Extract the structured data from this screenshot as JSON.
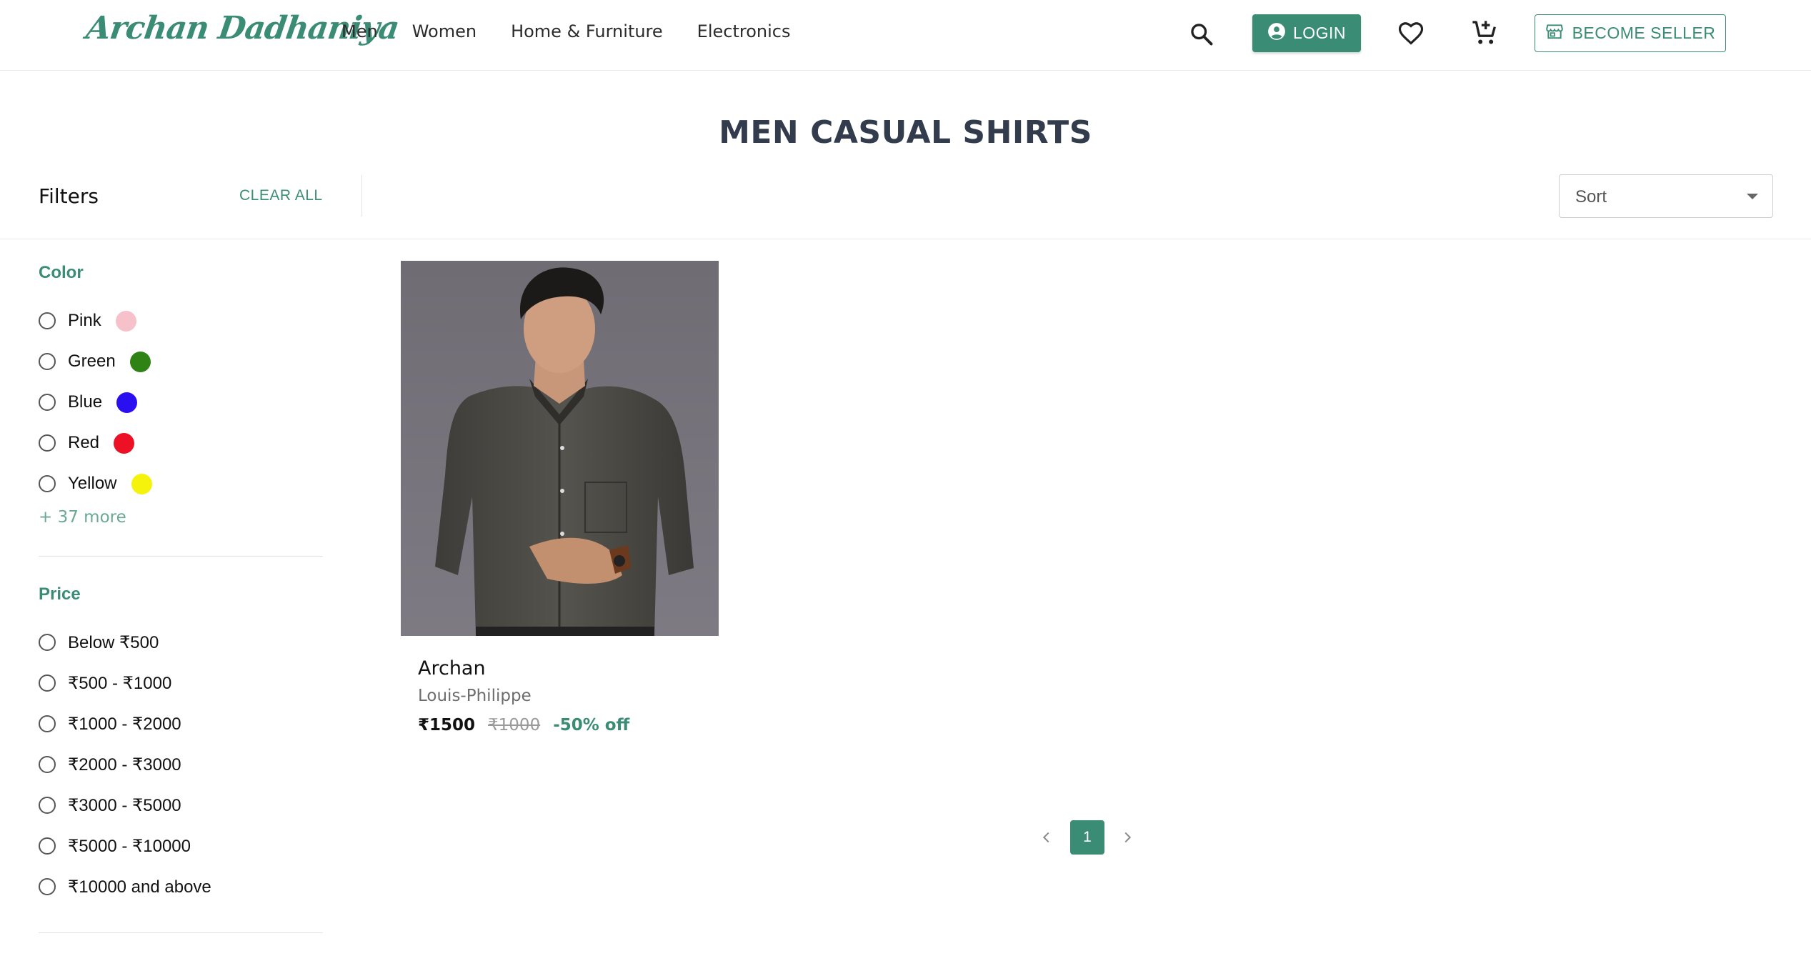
{
  "header": {
    "logo": "Archan Dadhaniya",
    "nav": [
      "Men",
      "Women",
      "Home & Furniture",
      "Electronics"
    ],
    "search_icon": "search-icon",
    "login_label": "LOGIN",
    "login_icon": "account-circle-icon",
    "wishlist_icon": "heart-icon",
    "cart_icon": "add-to-cart-icon",
    "seller_label": "BECOME SELLER",
    "seller_icon": "storefront-icon"
  },
  "page": {
    "title": "MEN CASUAL SHIRTS"
  },
  "filters": {
    "heading": "Filters",
    "clear_all": "CLEAR ALL",
    "color": {
      "title": "Color",
      "options": [
        {
          "label": "Pink",
          "swatch": "#f6c1cb"
        },
        {
          "label": "Green",
          "swatch": "#2f8214"
        },
        {
          "label": "Blue",
          "swatch": "#2a0ff0"
        },
        {
          "label": "Red",
          "swatch": "#ed1125"
        },
        {
          "label": "Yellow",
          "swatch": "#f5f20c"
        }
      ],
      "more": "+ 37 more"
    },
    "price": {
      "title": "Price",
      "options": [
        "Below ₹500",
        "₹500 - ₹1000",
        "₹1000 - ₹2000",
        "₹2000 - ₹3000",
        "₹3000 - ₹5000",
        "₹5000 - ₹10000",
        "₹10000 and above"
      ]
    }
  },
  "sort": {
    "placeholder": "Sort"
  },
  "products": [
    {
      "title": "Archan",
      "brand": "Louis-Philippe",
      "price": "₹1500",
      "mrp": "₹1000",
      "discount": "-50% off"
    }
  ],
  "pagination": {
    "current": "1",
    "prev_icon": "chevron-left-icon",
    "next_icon": "chevron-right-icon"
  },
  "theme": {
    "accent": "#3a8c74"
  }
}
